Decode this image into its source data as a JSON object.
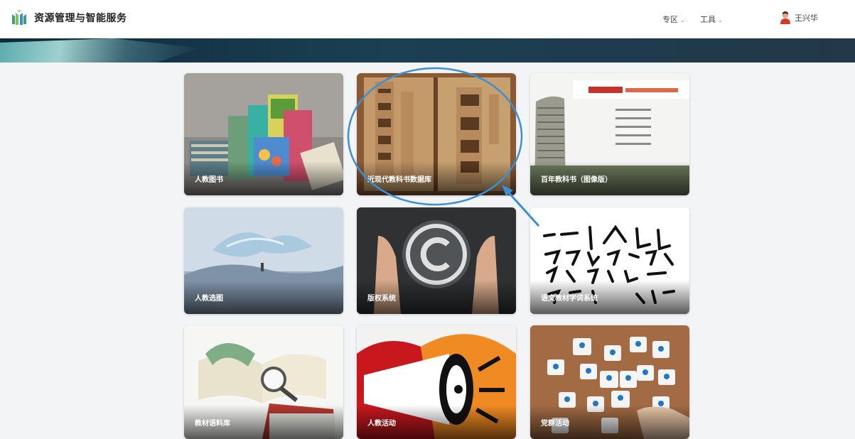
{
  "header": {
    "brand": "资源管理与智能服务",
    "nav": [
      {
        "label": "专区",
        "chev": "⌄"
      },
      {
        "label": "工具",
        "chev": "⌄"
      }
    ],
    "user_name": "王兴华"
  },
  "cards": [
    {
      "label": "人教图书"
    },
    {
      "label": "近现代教科书数据库"
    },
    {
      "label": "百年教科书（图像版）"
    },
    {
      "label": "人教选图"
    },
    {
      "label": "版权系统"
    },
    {
      "label": "语文教材字词系统"
    },
    {
      "label": "教材语料库"
    },
    {
      "label": "人教活动"
    },
    {
      "label": "党群活动"
    }
  ],
  "colors": {
    "accent_green": "#3aa36f",
    "annotation_blue": "#3b8fd9"
  },
  "icons": {
    "logo": "book-logo-icon",
    "user": "user-avatar-icon",
    "nav_chevron": "chevron-down-icon"
  }
}
